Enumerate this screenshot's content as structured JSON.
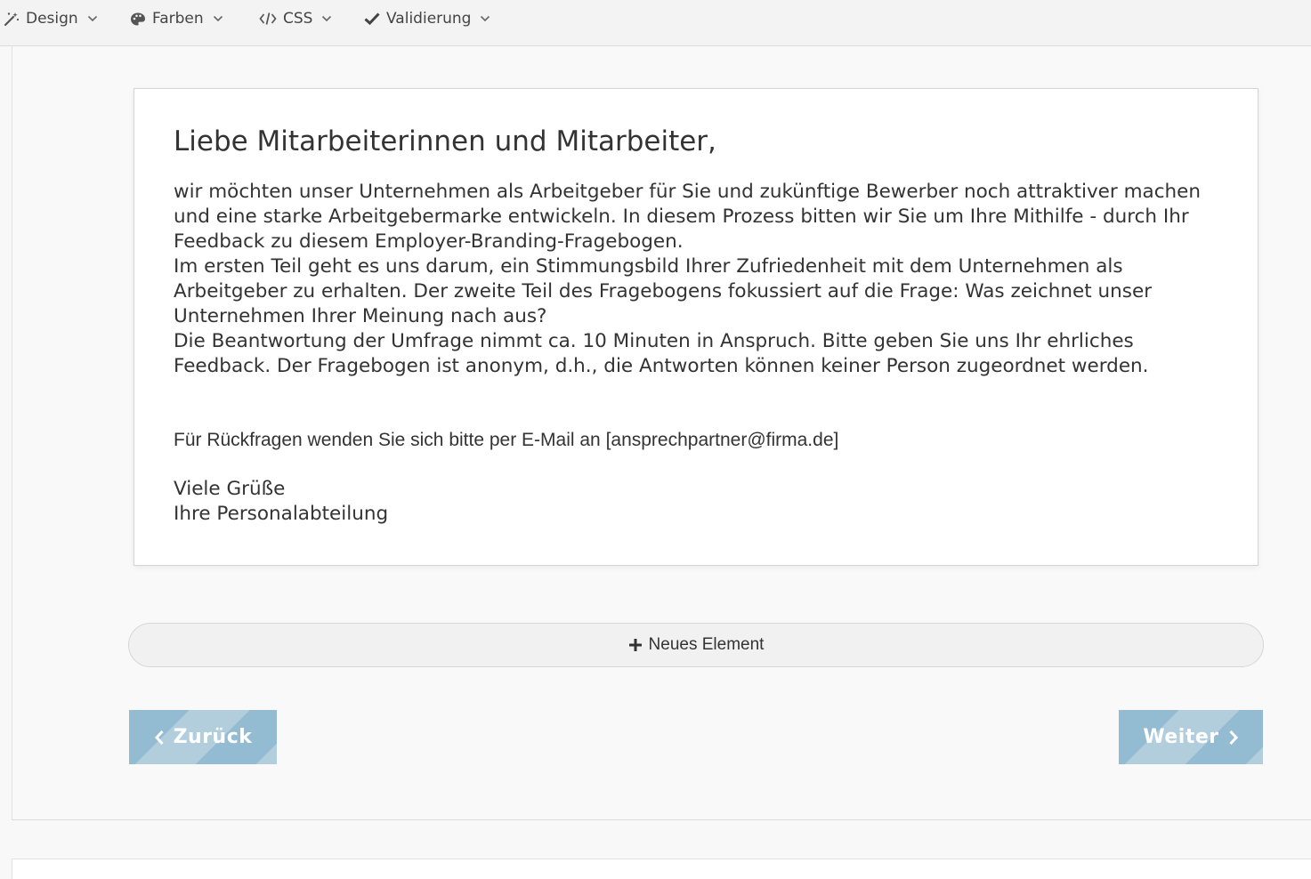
{
  "toolbar": {
    "items": [
      {
        "label": "Design",
        "icon": "magic-wand-icon"
      },
      {
        "label": "Farben",
        "icon": "palette-icon"
      },
      {
        "label": "CSS",
        "icon": "code-icon"
      },
      {
        "label": "Validierung",
        "icon": "checkmark-icon"
      }
    ]
  },
  "card": {
    "title": "Liebe Mitarbeiterinnen und Mitarbeiter,",
    "paragraphs": [
      "wir möchten unser Unternehmen als Arbeitgeber für Sie und zukünftige Bewerber noch attraktiver machen und eine starke Arbeitgebermarke entwickeln. In diesem Prozess bitten wir Sie um Ihre Mit­hilfe - durch Ihr Feedback zu diesem Employer-Branding-Fragebogen.",
      "Im ersten Teil geht es uns darum, ein Stimmungsbild Ihrer Zufriedenheit mit dem Unternehmen als Arbeitgeber zu erhalten. Der zweite Teil des Fragebogens fokussiert auf die Frage: Was zeichnet un­ser Unternehmen Ihrer Meinung nach aus?",
      "Die Beantwortung der Umfrage nimmt ca. 10 Minuten in Anspruch. Bitte geben Sie uns Ihr ehrliches Feedback. Der Fragebogen ist anonym, d.h., die Antworten können keiner Person zugeordnet wer­den."
    ],
    "contact": "Für Rückfragen wenden Sie sich bitte per E-Mail an [ansprechpartner@firma.de]",
    "closing_line1": "Viele Grüße",
    "closing_line2": "Ihre Personalabteilung"
  },
  "new_element": {
    "label": "Neues Element",
    "icon": "plus-icon"
  },
  "nav": {
    "back_label": "Zurück",
    "next_label": "Weiter"
  },
  "colors": {
    "nav_button_stripe_a": "#93bcd2",
    "nav_button_stripe_b": "#b2cedc"
  }
}
